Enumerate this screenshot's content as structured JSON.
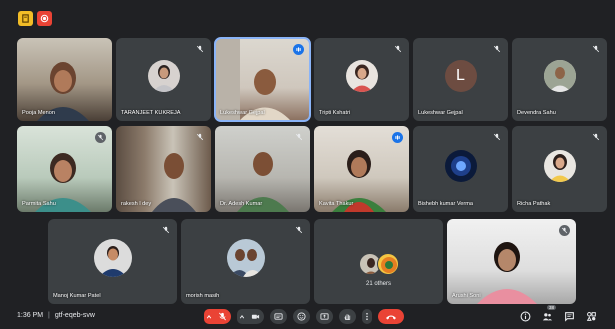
{
  "participants_row1": [
    {
      "name": "Pooja Menon",
      "kind": "video",
      "muted": false
    },
    {
      "name": "TARANJEET KUKREJA",
      "kind": "photo",
      "muted": true
    },
    {
      "name": "Lukeshwar Gejpal",
      "kind": "video",
      "speaking": true
    },
    {
      "name": "Tripti Kshatri",
      "kind": "photo",
      "muted": true
    },
    {
      "name": "Lukeshwar Gejpal",
      "kind": "letter",
      "letter": "L",
      "muted": true
    },
    {
      "name": "Devendra Sahu",
      "kind": "photo",
      "muted": true
    }
  ],
  "participants_row2": [
    {
      "name": "Parmita Sahu",
      "kind": "video",
      "muted": true
    },
    {
      "name": "rakesh l dey",
      "kind": "video",
      "muted": true
    },
    {
      "name": "Dr. Adesh Kumar",
      "kind": "video",
      "muted": true
    },
    {
      "name": "Kavita Thakur",
      "kind": "video",
      "speaking": true
    },
    {
      "name": "Bishebh kumar Verma",
      "kind": "photo",
      "muted": true
    },
    {
      "name": "Richa Pathak",
      "kind": "photo",
      "muted": true
    }
  ],
  "participants_row3": [
    {
      "name": "Manoj Kumar Patel",
      "kind": "photo",
      "muted": true
    },
    {
      "name": "morish masih",
      "kind": "photo",
      "muted": true
    },
    {
      "name": "21 others",
      "kind": "others"
    },
    {
      "name": "Arushi Soni",
      "kind": "video",
      "muted": true
    }
  ],
  "bottom": {
    "time": "1:36 PM",
    "separator": "|",
    "meeting_code": "gtf-eqeb-svw",
    "participant_count": "38"
  },
  "colors": {
    "accent": "#8ab4f8",
    "end_call": "#ea4335",
    "background": "#202124",
    "tile": "#3c4043"
  }
}
